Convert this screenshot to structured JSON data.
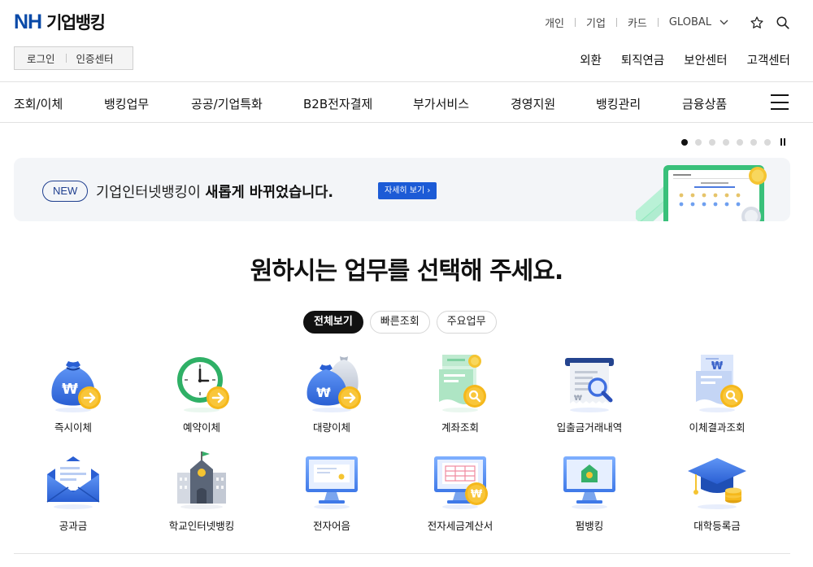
{
  "logo": {
    "brand": "NH",
    "name": "기업뱅킹"
  },
  "utility_nav": [
    "개인",
    "기업",
    "카드",
    "GLOBAL"
  ],
  "login": {
    "login_label": "로그인",
    "cert_label": "인증센터"
  },
  "quick_links": [
    "외환",
    "퇴직연금",
    "보안센터",
    "고객센터"
  ],
  "gnb": [
    "조회/이체",
    "뱅킹업무",
    "공공/기업특화",
    "B2B전자결제",
    "부가서비스",
    "경영지원",
    "뱅킹관리",
    "금융상품"
  ],
  "carousel": {
    "slide_count": 7,
    "active_index": 0
  },
  "banner": {
    "badge": "NEW",
    "text_prefix": "기업인터넷뱅킹이 ",
    "text_bold": "새롭게 바뀌었습니다.",
    "more_label": "자세히 보기 ›"
  },
  "headline": "원하시는 업무를 선택해 주세요.",
  "tabs": [
    {
      "label": "전체보기",
      "active": true
    },
    {
      "label": "빠른조회",
      "active": false
    },
    {
      "label": "주요업무",
      "active": false
    }
  ],
  "services": [
    {
      "label": "즉시이체",
      "icon": "money-bag-arrow-icon"
    },
    {
      "label": "예약이체",
      "icon": "clock-arrow-icon"
    },
    {
      "label": "대량이체",
      "icon": "money-bags-arrow-icon"
    },
    {
      "label": "계좌조회",
      "icon": "document-search-icon"
    },
    {
      "label": "입출금거래내역",
      "icon": "receipt-magnifier-icon"
    },
    {
      "label": "이체결과조회",
      "icon": "transfer-result-icon"
    },
    {
      "label": "공과금",
      "icon": "envelope-icon"
    },
    {
      "label": "학교인터넷뱅킹",
      "icon": "school-icon"
    },
    {
      "label": "전자어음",
      "icon": "monitor-bill-icon"
    },
    {
      "label": "전자세금계산서",
      "icon": "monitor-invoice-icon"
    },
    {
      "label": "펌뱅킹",
      "icon": "monitor-bank-icon"
    },
    {
      "label": "대학등록금",
      "icon": "graduation-cap-icon"
    }
  ],
  "colors": {
    "brand_blue": "#0a4aa8",
    "button_blue": "#1c5bd6",
    "accent_yellow": "#f5b81c",
    "accent_green": "#36c47a"
  }
}
